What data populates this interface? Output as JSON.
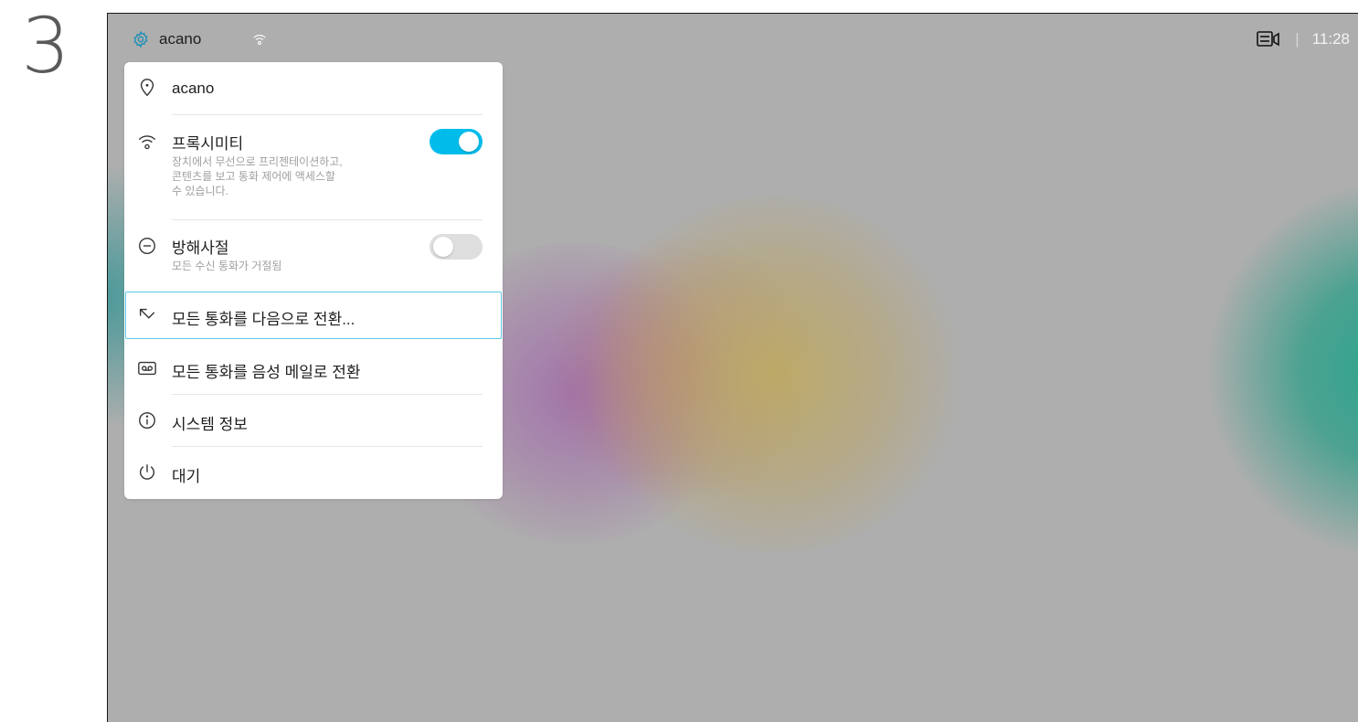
{
  "step_number": "3",
  "status_bar": {
    "device_name": "acano",
    "left_icons": [
      "gear-icon",
      "wireless-icon"
    ],
    "right_icon": "video-layout-icon",
    "separator": "|",
    "time": "11:28"
  },
  "menu": {
    "location": {
      "icon": "location-pin-icon",
      "label": "acano"
    },
    "proximity": {
      "icon": "wireless-icon",
      "label": "프록시미티",
      "description_lines": [
        "장치에서 무선으로 프리젠테이션하고,",
        "콘텐츠를 보고 통화 제어에 액세스할",
        "수 있습니다."
      ],
      "enabled": true
    },
    "do_not_disturb": {
      "icon": "minus-circle-icon",
      "label": "방해사절",
      "description": "모든 수신 통화가 거절됨",
      "enabled": false
    },
    "forward_all": {
      "icon": "forward-arrow-icon",
      "label": "모든 통화를 다음으로 전환...",
      "selected": true
    },
    "voicemail": {
      "icon": "voicemail-icon",
      "label": "모든 통화를 음성 메일로 전환"
    },
    "system_info": {
      "icon": "info-icon",
      "label": "시스템 정보"
    },
    "standby": {
      "icon": "power-icon",
      "label": "대기"
    }
  },
  "colors": {
    "accent": "#00bceb",
    "toggle_off": "#dedede",
    "panel_bg": "#ffffff",
    "screen_bg": "#aeaeae"
  }
}
